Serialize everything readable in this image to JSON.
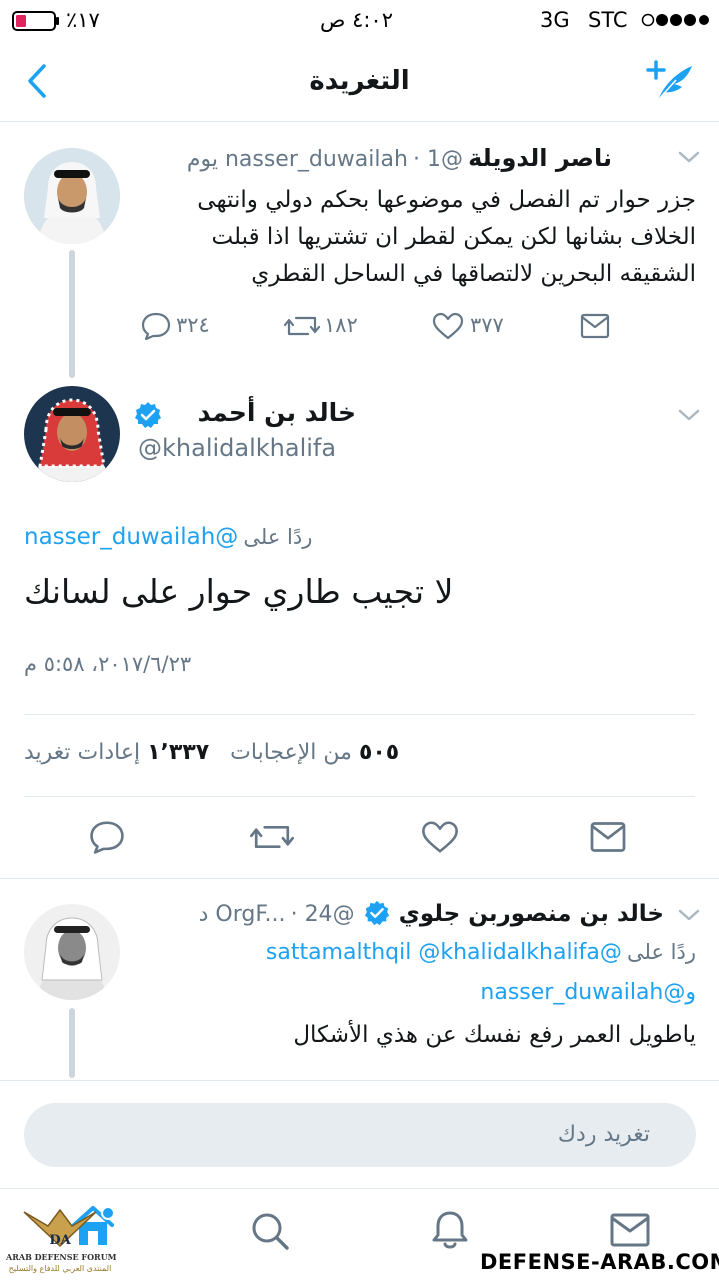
{
  "status_bar": {
    "battery": "٪١٧",
    "time": "٤:٠٢ ص",
    "network": "3G",
    "carrier": "STC"
  },
  "nav": {
    "title": "التغريدة",
    "back_icon": "chevron-left-icon",
    "compose_icon": "compose-tweet-icon"
  },
  "parent_tweet": {
    "name": "ناصر الدويلة",
    "handle": "@nasser_duwailah",
    "time": "1 يوم",
    "text": "جزر حوار تم الفصل في موضوعها بحكم دولي وانتهى الخلاف بشانها لكن يمكن لقطر ان تشتريها اذا قبلت الشقيقه البحرين لالتصاقها في الساحل القطري",
    "reply_count": "٣٢٤",
    "retweet_count": "١٨٢",
    "like_count": "٣٧٧"
  },
  "main_tweet": {
    "name": "خالد بن أحمد",
    "handle": "@khalidalkhalifa",
    "verified": true,
    "reply_to_prefix": "ردًا على",
    "reply_to_handle": "@nasser_duwailah",
    "text": "لا تجيب طاري حوار على لسانك",
    "timestamp": "٢٠١٧/٦/٢٣، ٥:٥٨ م",
    "likes_count": "٥٠٥",
    "likes_label": "من الإعجابات",
    "retweets_count": "١٬٣٣٧",
    "retweets_label": "إعادات تغريد"
  },
  "reply_tweet": {
    "name": "خالد بن منصوربن جلوي",
    "handle": "@OrgF...",
    "time": "24 د",
    "verified": true,
    "reply_to_prefix": "ردًا على",
    "reply_to_handles": "@sattamalthqil @khalidalkhalifa",
    "reply_to_tail": "و@nasser_duwailah",
    "text": "ياطويل العمر رفع نفسك عن هذي الأشكال"
  },
  "reply_box": {
    "placeholder": "تغريد ردك"
  },
  "watermark": {
    "site": "DEFENSE-ARAB.COM",
    "forum_en": "ARAB DEFENSE FORUM",
    "forum_ar": "المنتدى العربي للدفاع والتسليح"
  },
  "colors": {
    "accent": "#1da1f2",
    "muted": "#657786",
    "divider": "#e1e8ed",
    "battery_low": "#e0245e"
  }
}
